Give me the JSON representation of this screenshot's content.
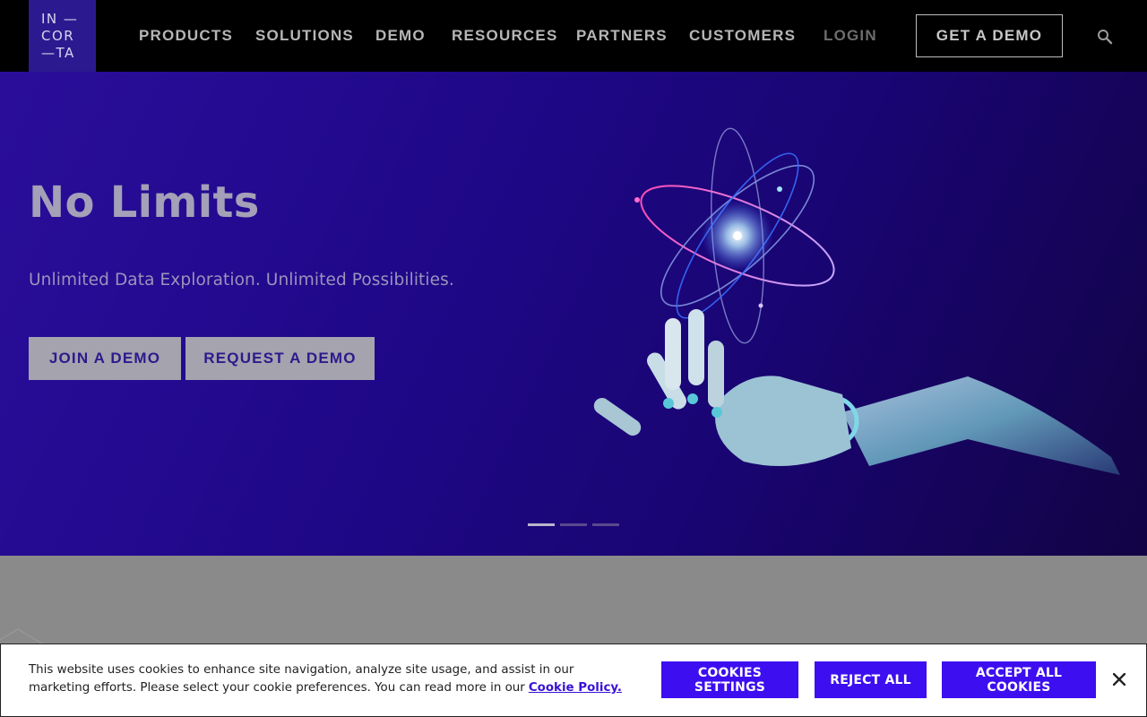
{
  "nav": {
    "logo_lines": [
      "IN —",
      "COR",
      "—TA"
    ],
    "links": [
      {
        "label": "PRODUCTS"
      },
      {
        "label": "SOLUTIONS"
      },
      {
        "label": "DEMO"
      },
      {
        "label": "RESOURCES"
      },
      {
        "label": "PARTNERS"
      },
      {
        "label": "CUSTOMERS"
      }
    ],
    "login_label": "LOGIN",
    "cta_label": "GET A DEMO",
    "search_icon": "search-icon"
  },
  "hero": {
    "title": "No Limits",
    "subtitle": "Unlimited Data Exploration. Unlimited Possibilities.",
    "primary_button": "JOIN A DEMO",
    "secondary_button": "REQUEST A DEMO",
    "slides_total": 3,
    "active_slide": 1,
    "image": "robot-hand-atom-illustration"
  },
  "cookie_banner": {
    "text": "This website uses cookies to enhance site navigation, analyze site usage, and assist in our marketing efforts. Please select your cookie preferences. You can read more in our",
    "policy_link": "Cookie Policy.",
    "settings_button": "COOKIES SETTINGS",
    "reject_button": "REJECT ALL",
    "accept_button": "ACCEPT ALL COOKIES",
    "close_icon": "close-icon"
  },
  "colors": {
    "nav_bg": "#000000",
    "logo_bg": "#2b1a8f",
    "hero_bg": "#20088a",
    "cookie_button": "#3d0ef0",
    "cookie_link": "#3a12d6"
  }
}
